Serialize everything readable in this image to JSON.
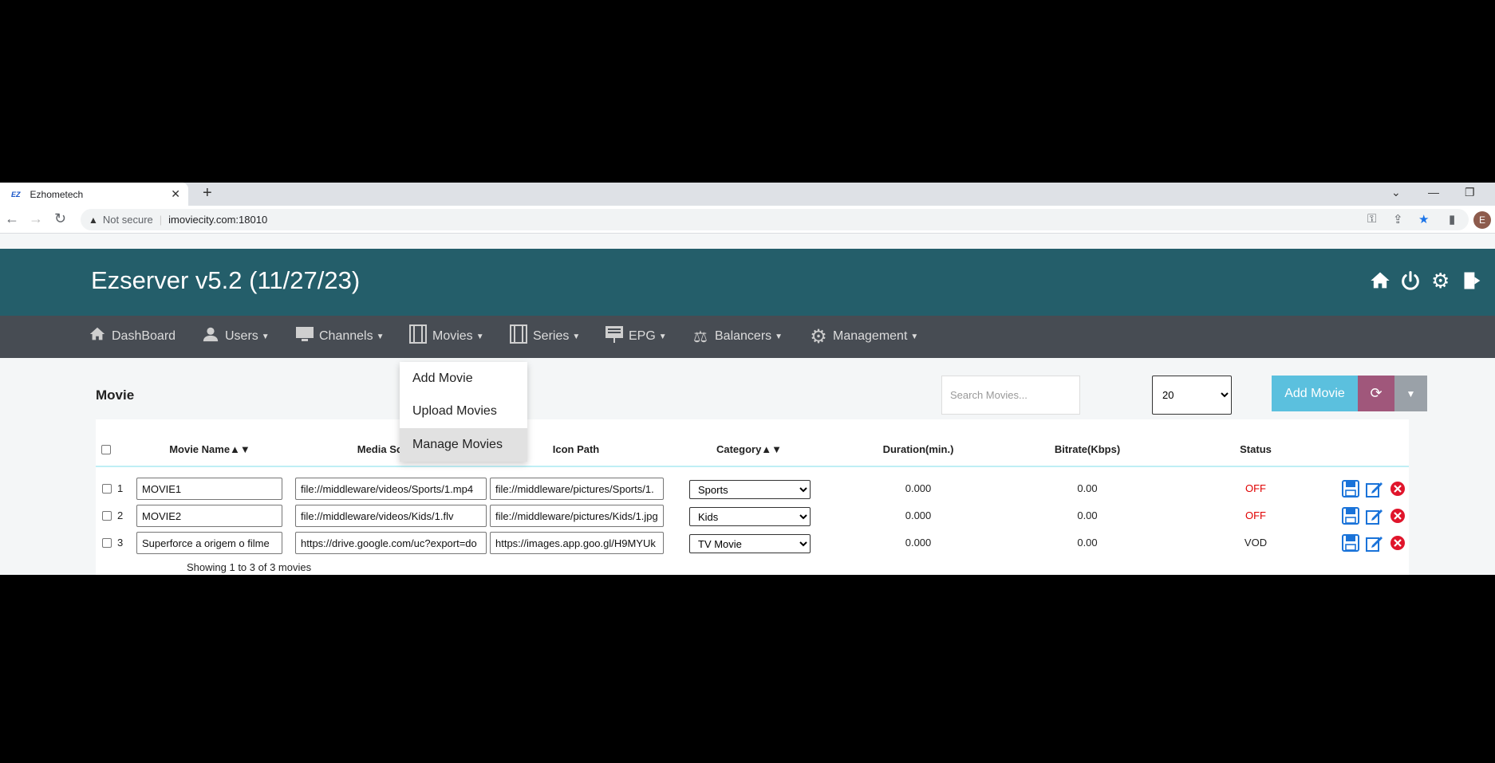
{
  "browser": {
    "tab_title": "Ezhometech",
    "favicon_text": "EZ",
    "security_label": "Not secure",
    "url": "imoviecity.com:18010",
    "avatar_letter": "E"
  },
  "app": {
    "title": "Ezserver v5.2 (11/27/23)",
    "header_icons": [
      "home-icon",
      "power-icon",
      "gear-icon",
      "logout-icon"
    ]
  },
  "nav": {
    "items": [
      {
        "label": "DashBoard",
        "icon": "home-icon",
        "dropdown": false
      },
      {
        "label": "Users",
        "icon": "user-icon",
        "dropdown": true
      },
      {
        "label": "Channels",
        "icon": "monitor-icon",
        "dropdown": true
      },
      {
        "label": "Movies",
        "icon": "film-icon",
        "dropdown": true
      },
      {
        "label": "Series",
        "icon": "film-icon",
        "dropdown": true
      },
      {
        "label": "EPG",
        "icon": "presentation-icon",
        "dropdown": true
      },
      {
        "label": "Balancers",
        "icon": "scale-icon",
        "dropdown": true
      },
      {
        "label": "Management",
        "icon": "gear-icon",
        "dropdown": true
      }
    ]
  },
  "movies_menu": {
    "items": [
      "Add Movie",
      "Upload Movies",
      "Manage Movies"
    ],
    "active": "Manage Movies"
  },
  "page": {
    "title": "Movie",
    "search_placeholder": "Search Movies...",
    "per_page": "20",
    "add_button": "Add Movie"
  },
  "table": {
    "headers": {
      "name": "Movie Name▲▼",
      "media": "Media Source",
      "icon": "Icon Path",
      "category": "Category▲▼",
      "duration": "Duration(min.)",
      "bitrate": "Bitrate(Kbps)",
      "status": "Status"
    },
    "rows": [
      {
        "num": "1",
        "name": "MOVIE1",
        "media": "file://middleware/videos/Sports/1.mp4",
        "icon": "file://middleware/pictures/Sports/1.",
        "category": "Sports",
        "duration": "0.000",
        "bitrate": "0.00",
        "status": "OFF"
      },
      {
        "num": "2",
        "name": "MOVIE2",
        "media": "file://middleware/videos/Kids/1.flv",
        "icon": "file://middleware/pictures/Kids/1.jpg",
        "category": "Kids",
        "duration": "0.000",
        "bitrate": "0.00",
        "status": "OFF"
      },
      {
        "num": "3",
        "name": "Superforce a origem o filme",
        "media": "https://drive.google.com/uc?export=do",
        "icon": "https://images.app.goo.gl/H9MYUk",
        "category": "TV Movie",
        "duration": "0.000",
        "bitrate": "0.00",
        "status": "VOD"
      }
    ],
    "summary": "Showing 1 to 3 of 3 movies"
  },
  "colors": {
    "header": "#245e6a",
    "navbar": "#474c53",
    "status_off": "#e00000",
    "status_vod": "#222222",
    "add_button": "#5bc0de",
    "refresh_button": "#a0577b"
  }
}
